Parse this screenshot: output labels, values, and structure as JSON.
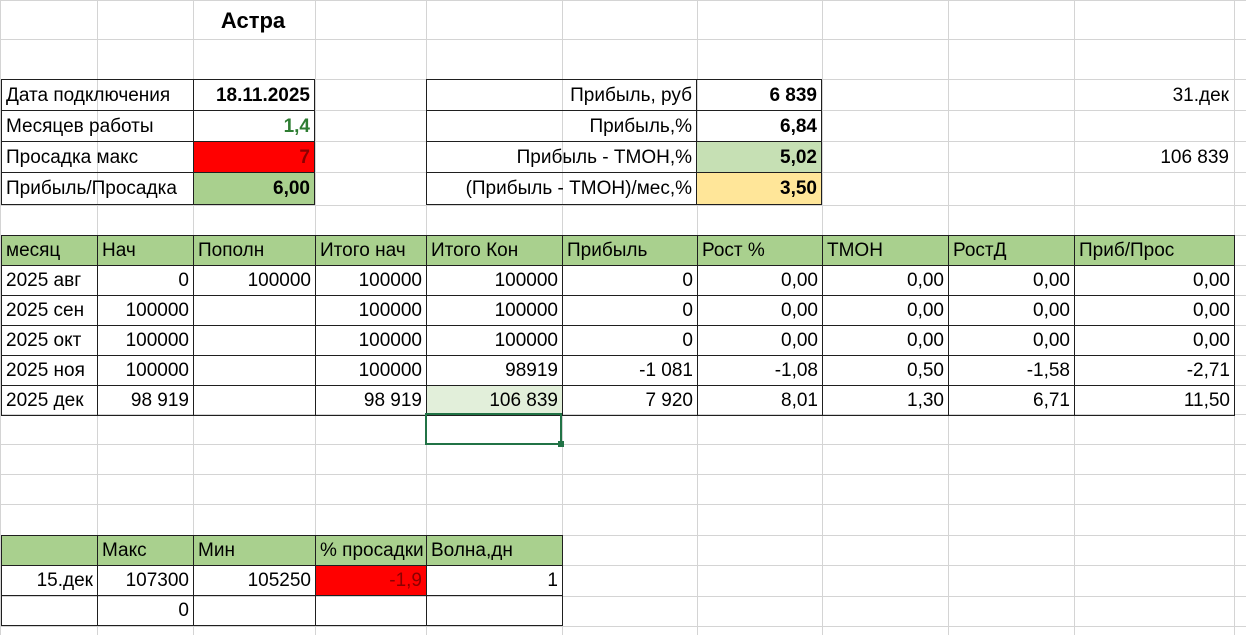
{
  "sheet": {
    "title": "Астра"
  },
  "info": {
    "connect_date": {
      "label": "Дата подключения",
      "value": "18.11.2025"
    },
    "months_work": {
      "label": "Месяцев работы",
      "value": "1,4"
    },
    "max_drawdown": {
      "label": "Просадка макс",
      "value": "7"
    },
    "profit_drawdown": {
      "label": "Прибыль/Просадка",
      "value": "6,00"
    }
  },
  "profit": {
    "rub": {
      "label": "Прибыль, руб",
      "value": "6 839"
    },
    "pct": {
      "label": "Прибыль,%",
      "value": "6,84"
    },
    "minus_tmon": {
      "label": "Прибыль - ТМОН,%",
      "value": "5,02"
    },
    "per_month": {
      "label": "(Прибыль - ТМОН)/мес,%",
      "value": "3,50"
    }
  },
  "side": {
    "date": "31.дек",
    "amount": "106 839"
  },
  "table": {
    "headers": [
      "месяц",
      "Нач",
      "Пополн",
      "Итого нач",
      "Итого Кон",
      "Прибыль",
      "Рост %",
      "ТМОН",
      "РостД",
      "Приб/Прос"
    ],
    "rows": [
      [
        "2025 авг",
        "0",
        "100000",
        "100000",
        "100000",
        "0",
        "0,00",
        "0,00",
        "0,00",
        "0,00"
      ],
      [
        "2025 сен",
        "100000",
        "",
        "100000",
        "100000",
        "0",
        "0,00",
        "0,00",
        "0,00",
        "0,00"
      ],
      [
        "2025 окт",
        "100000",
        "",
        "100000",
        "100000",
        "0",
        "0,00",
        "0,00",
        "0,00",
        "0,00"
      ],
      [
        "2025 ноя",
        "100000",
        "",
        "100000",
        "98919",
        "-1 081",
        "-1,08",
        "0,50",
        "-1,58",
        "-2,71"
      ],
      [
        "2025 дек",
        "98 919",
        "",
        "98 919",
        "106 839",
        "7 920",
        "8,01",
        "1,30",
        "6,71",
        "11,50"
      ]
    ]
  },
  "wave": {
    "headers": [
      "",
      "Макс",
      "Мин",
      "% просадки",
      "Волна,дн"
    ],
    "rows": [
      [
        "15.дек",
        "107300",
        "105250",
        "-1,9",
        "1"
      ],
      [
        "",
        "0",
        "",
        "",
        ""
      ]
    ]
  }
}
